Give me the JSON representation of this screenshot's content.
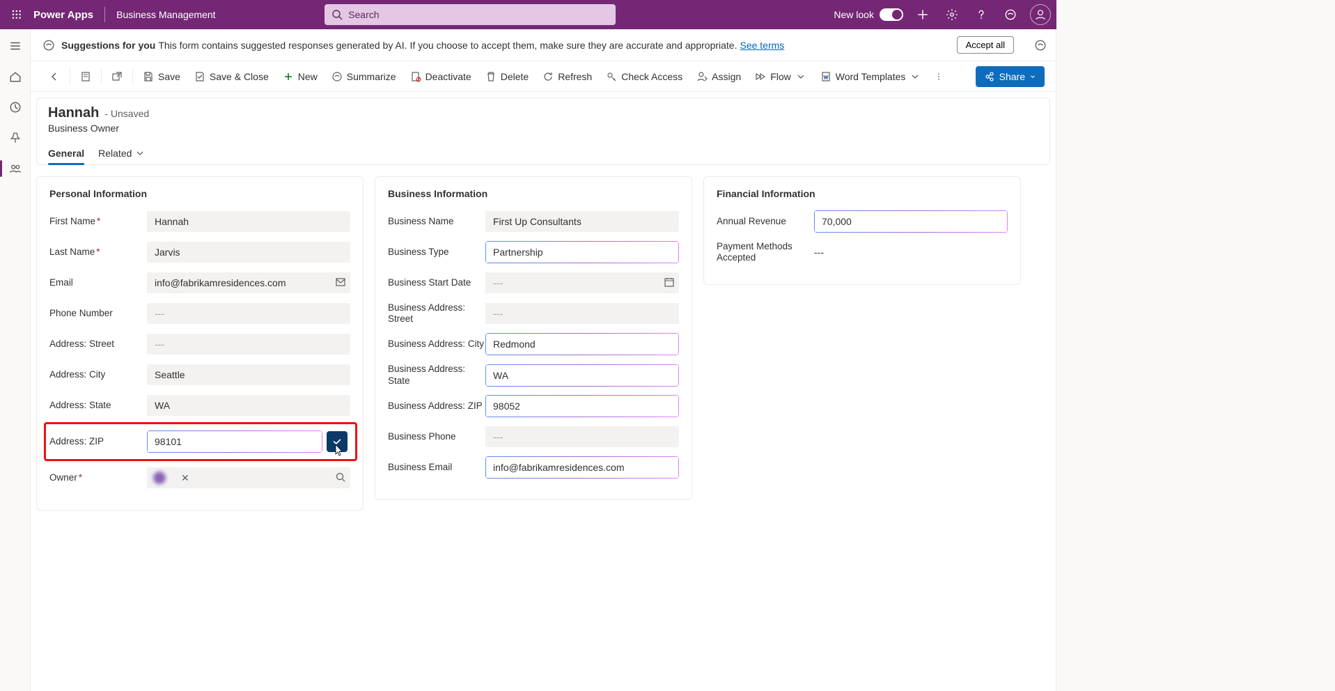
{
  "appbar": {
    "brand": "Power Apps",
    "workload": "Business Management",
    "search_placeholder": "Search",
    "newlook_label": "New look"
  },
  "suggestions": {
    "lead": "Suggestions for you",
    "body": "This form contains suggested responses generated by AI. If you choose to accept them, make sure they are accurate and appropriate.",
    "link": "See terms",
    "accept_all": "Accept all"
  },
  "commands": {
    "save": "Save",
    "save_close": "Save & Close",
    "new": "New",
    "summarize": "Summarize",
    "deactivate": "Deactivate",
    "delete": "Delete",
    "refresh": "Refresh",
    "check_access": "Check Access",
    "assign": "Assign",
    "flow": "Flow",
    "word_templates": "Word Templates",
    "share": "Share"
  },
  "header": {
    "title": "Hannah",
    "unsaved": "- Unsaved",
    "subtitle": "Business Owner",
    "tabs": {
      "general": "General",
      "related": "Related"
    }
  },
  "sections": {
    "personal": "Personal Information",
    "business": "Business Information",
    "financial": "Financial Information"
  },
  "labels": {
    "first_name": "First Name",
    "last_name": "Last Name",
    "email": "Email",
    "phone": "Phone Number",
    "addr_street": "Address: Street",
    "addr_city": "Address: City",
    "addr_state": "Address: State",
    "addr_zip": "Address: ZIP",
    "owner": "Owner",
    "biz_name": "Business Name",
    "biz_type": "Business Type",
    "biz_start": "Business Start Date",
    "biz_addr_street": "Business Address: Street",
    "biz_addr_city": "Business Address: City",
    "biz_addr_state": "Business Address: State",
    "biz_addr_zip": "Business Address: ZIP",
    "biz_phone": "Business Phone",
    "biz_email": "Business Email",
    "annual_revenue": "Annual Revenue",
    "payment_methods": "Payment Methods Accepted"
  },
  "values": {
    "first_name": "Hannah",
    "last_name": "Jarvis",
    "email": "info@fabrikamresidences.com",
    "phone": "---",
    "addr_street": "---",
    "addr_city": "Seattle",
    "addr_state": "WA",
    "addr_zip": "98101",
    "owner": "",
    "biz_name": "First Up Consultants",
    "biz_type": "Partnership",
    "biz_start": "---",
    "biz_addr_street": "---",
    "biz_addr_city": "Redmond",
    "biz_addr_state": "WA",
    "biz_addr_zip": "98052",
    "biz_phone": "---",
    "biz_email": "info@fabrikamresidences.com",
    "annual_revenue": "70,000",
    "payment_methods": "---"
  }
}
